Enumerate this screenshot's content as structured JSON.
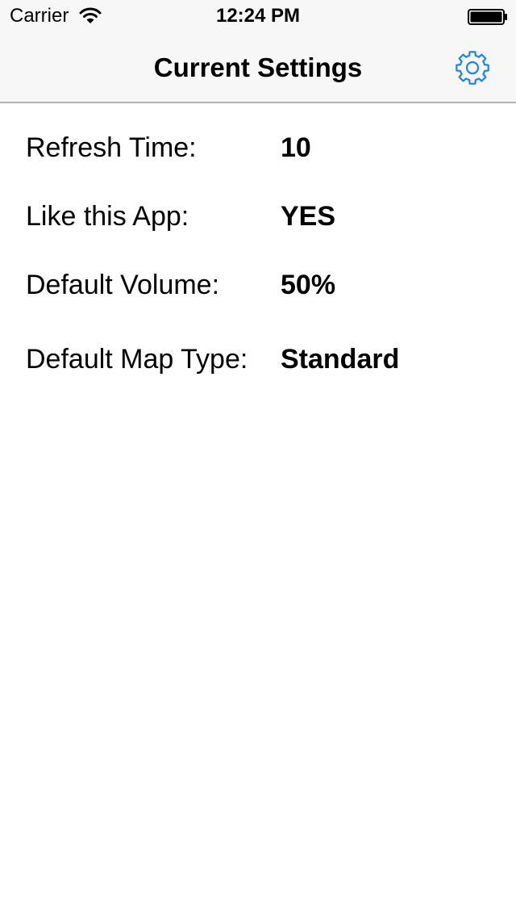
{
  "status_bar": {
    "carrier": "Carrier",
    "time": "12:24 PM",
    "wifi_icon": "wifi-icon",
    "battery_icon": "battery-icon"
  },
  "nav_bar": {
    "title": "Current Settings",
    "settings_icon": "gear-icon",
    "accent_color": "#1a82fb"
  },
  "settings": [
    {
      "label": "Refresh Time:",
      "value": "10"
    },
    {
      "label": "Like this App:",
      "value": "YES"
    },
    {
      "label": "Default Volume:",
      "value": "50%"
    },
    {
      "label": "Default Map Type:",
      "value": "Standard"
    }
  ]
}
